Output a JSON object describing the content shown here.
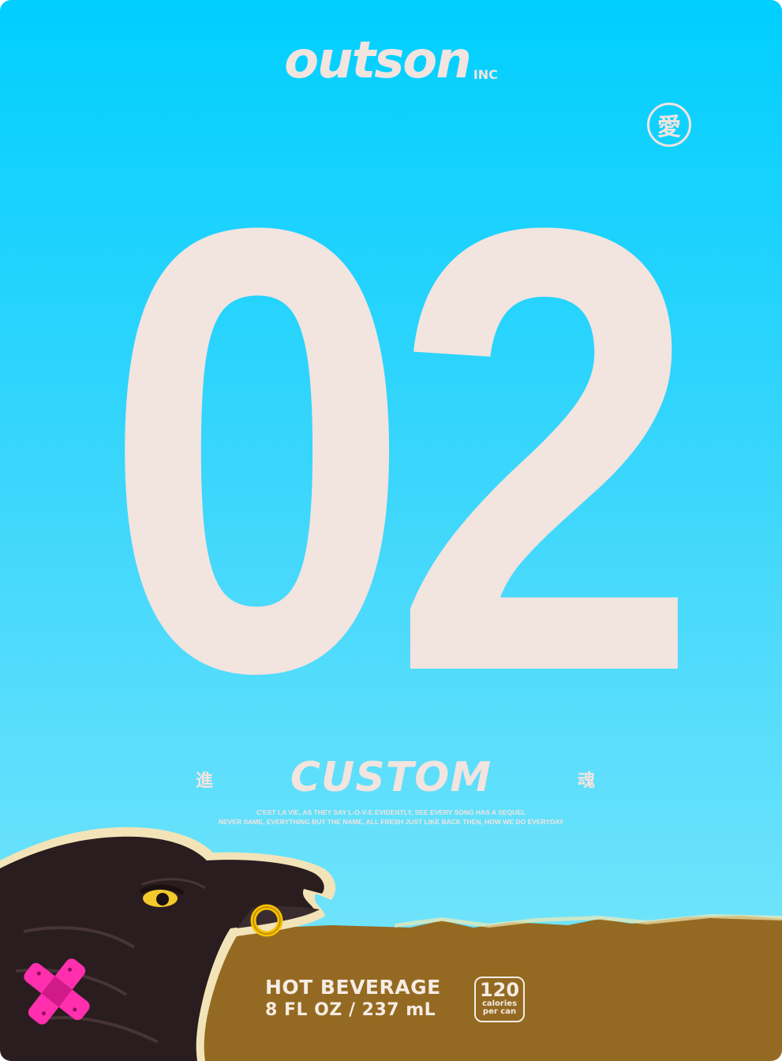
{
  "brand": {
    "name": "outson",
    "suffix": "INC"
  },
  "badge": {
    "glyph": "愛"
  },
  "product": {
    "number": "02",
    "name": "CUSTOM",
    "side_left": "進",
    "side_right": "魂",
    "tagline_line1": "C'EST LA VIE, AS THEY SAY L-O-V-E EVIDENTLY, SEE EVERY SONG HAS A SEQUEL",
    "tagline_line2": "NEVER SAME, EVERYTHING BUT THE NAME, ALL FRESH JUST LIKE BACK THEN, HOW WE DO EVERYDAY"
  },
  "info": {
    "type": "HOT BEVERAGE",
    "volume": "8 FL OZ / 237 mL",
    "calories": "120",
    "calories_unit_1": "calories",
    "calories_unit_2": "per can"
  },
  "colors": {
    "sky_top": "#00cfff",
    "sky_bottom": "#7ee7fb",
    "cream": "#f2e4df",
    "ground": "#946a22",
    "crow": "#2a1d1f",
    "bandage": "#ff2fae",
    "ring": "#f6c400"
  },
  "illustration": {
    "subject": "crow-with-gold-ring-and-bandage"
  }
}
